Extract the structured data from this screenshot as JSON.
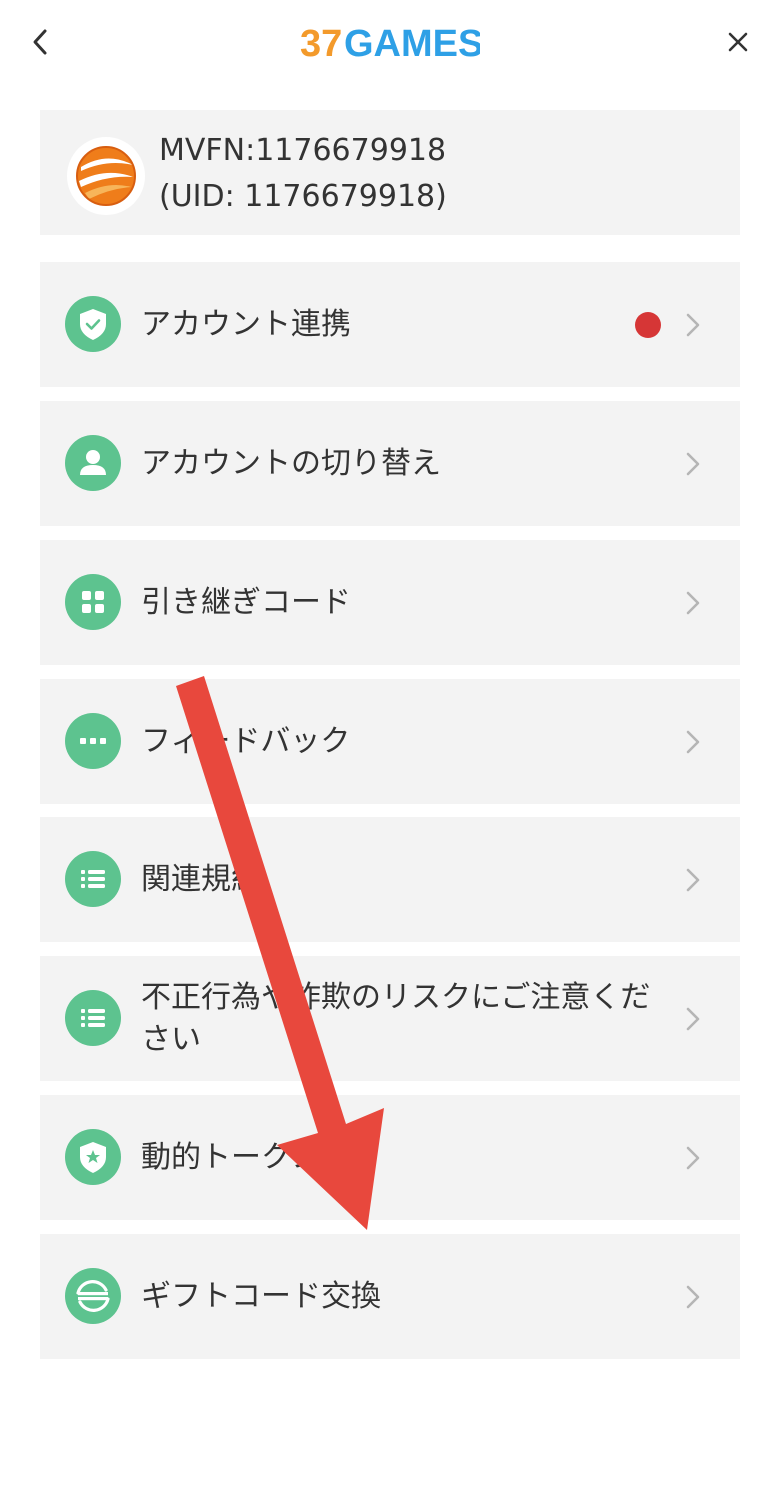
{
  "header": {
    "logo_text_number": "37",
    "logo_text_word": "GAMES",
    "back_icon": "chevron-left-icon",
    "close_icon": "close-icon"
  },
  "user": {
    "name": "MVFN:1176679918",
    "uid": "(UID: 1176679918)"
  },
  "colors": {
    "accent_green": "#5dc38f",
    "card_background": "#f3f3f3",
    "badge_red": "#d63636",
    "logo_orange": "#f39a2b",
    "logo_blue": "#2ea0e6",
    "annotation_arrow": "#e8483d"
  },
  "menu": [
    {
      "label": "アカウント連携",
      "icon": "shield-check-icon",
      "badge": true
    },
    {
      "label": "アカウントの切り替え",
      "icon": "user-icon",
      "badge": false
    },
    {
      "label": "引き継ぎコード",
      "icon": "grid-icon",
      "badge": false
    },
    {
      "label": "フィードバック",
      "icon": "dots-icon",
      "badge": false
    },
    {
      "label": "関連規約",
      "icon": "list-icon",
      "badge": false
    },
    {
      "label": "不正行為や詐欺のリスクにご注意ください",
      "icon": "list-icon",
      "badge": false
    },
    {
      "label": "動的トークン",
      "icon": "shield-star-icon",
      "badge": false
    },
    {
      "label": "ギフトコード交換",
      "icon": "exchange-icon",
      "badge": false
    }
  ]
}
